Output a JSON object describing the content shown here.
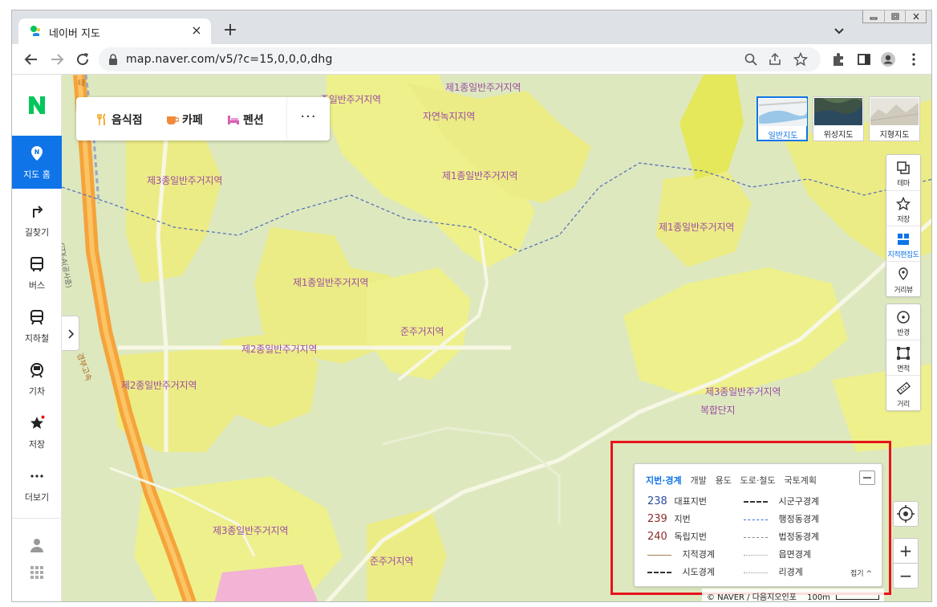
{
  "browser": {
    "tab_title": "네이버 지도",
    "tab_close": "×",
    "new_tab": "+",
    "url": "map.naver.com/v5/?c=15,0,0,0,dhg"
  },
  "sidebar": {
    "logo": "N",
    "items": [
      {
        "label": "지도 홈",
        "icon": "map-pin-icon",
        "active": true
      },
      {
        "label": "길찾기",
        "icon": "directions-icon"
      },
      {
        "label": "버스",
        "icon": "bus-icon"
      },
      {
        "label": "지하철",
        "icon": "subway-icon"
      },
      {
        "label": "기차",
        "icon": "train-icon"
      },
      {
        "label": "저장",
        "icon": "star-icon"
      },
      {
        "label": "더보기",
        "icon": "more-icon"
      }
    ]
  },
  "categories": {
    "items": [
      {
        "label": "음식점",
        "icon": "restaurant-icon",
        "color": "#f4a523"
      },
      {
        "label": "카페",
        "icon": "cafe-icon",
        "color": "#f08a3c"
      },
      {
        "label": "펜션",
        "icon": "bed-icon",
        "color": "#d85fb3"
      }
    ],
    "more": "···"
  },
  "map_types": [
    {
      "label": "일반지도",
      "active": true
    },
    {
      "label": "위성지도"
    },
    {
      "label": "지형지도"
    }
  ],
  "tools": {
    "group1": [
      {
        "label": "테마",
        "icon": "layers-icon"
      },
      {
        "label": "저장",
        "icon": "star-outline-icon"
      },
      {
        "label": "지적편집도",
        "icon": "cadastral-icon",
        "active": true
      },
      {
        "label": "거리뷰",
        "icon": "streetview-icon"
      }
    ],
    "group2": [
      {
        "label": "반경",
        "icon": "radius-icon"
      },
      {
        "label": "면적",
        "icon": "area-icon"
      },
      {
        "label": "거리",
        "icon": "ruler-icon"
      }
    ],
    "zoom_in": "+",
    "zoom_out": "−"
  },
  "map_labels": {
    "zone_1": "제1종일반주거지역",
    "zone_2": "제2종일반주거지역",
    "zone_3": "제3종일반주거지역",
    "zone_3_partial": "종일반주거지역",
    "quasi_res": "준주거지역",
    "green": "자연녹지지역",
    "complex": "복합단지",
    "expressway": "경부고속",
    "gtx": "GTX-A(공사중)",
    "road_partial": "태"
  },
  "legend": {
    "tabs": [
      "지번·경계",
      "개발",
      "용도",
      "도로·철도",
      "국토계획"
    ],
    "minimize": "−",
    "parcels": [
      {
        "num": "238",
        "label": "대표지번",
        "color": "#2b4c9b"
      },
      {
        "num": "239",
        "label": "지번",
        "color": "#8b2c2c"
      },
      {
        "num": "240",
        "label": "독립지번",
        "color": "#8b2c2c"
      }
    ],
    "lines_left": [
      {
        "label": "지적경계",
        "color": "#a1804f",
        "style": "solid"
      },
      {
        "label": "시도경계",
        "color": "#333333",
        "style": "dashed"
      }
    ],
    "lines_right": [
      {
        "label": "시군구경계",
        "color": "#333333",
        "style": "dashed"
      },
      {
        "label": "행정동경계",
        "color": "#3c6ed8",
        "style": "dashed"
      },
      {
        "label": "법정동경계",
        "color": "#888888",
        "style": "dashed"
      },
      {
        "label": "읍면경계",
        "color": "#9a9a9a",
        "style": "dotted"
      },
      {
        "label": "리경계",
        "color": "#9a9a9a",
        "style": "dotted"
      }
    ],
    "fold": "접기 ^"
  },
  "footer": {
    "copyright": "© NAVER / 다음지오인포",
    "scale": "100m"
  },
  "colors": {
    "accent": "#0f74e8",
    "naver_green": "#03c75a",
    "highlight": "#e5141a",
    "zone_label": "#9c4ea3"
  }
}
